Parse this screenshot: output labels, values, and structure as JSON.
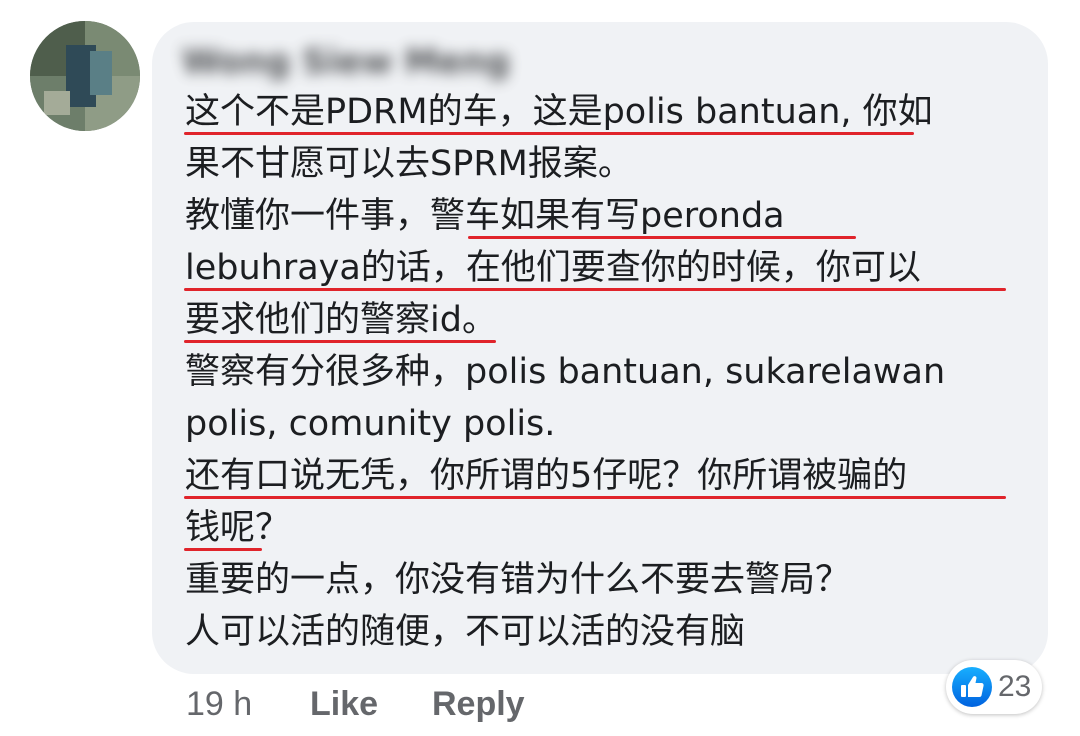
{
  "comment": {
    "author_name": "Wong Siew Meng",
    "lines": [
      "这个不是PDRM的车，这是polis bantuan, 你如",
      "果不甘愿可以去SPRM报案。",
      "教懂你一件事，警车如果有写peronda",
      "lebuhraya的话，在他们要查你的时候，你可以",
      "要求他们的警察id。",
      "警察有分很多种，polis bantuan, sukarelawan",
      "polis, comunity polis.",
      "还有口说无凭，你所谓的5仔呢？你所谓被骗的",
      "钱呢？",
      "重要的一点，你没有错为什么不要去警局？",
      "人可以活的随便，不可以活的没有脑"
    ],
    "underline_color": "#e0242b"
  },
  "footer": {
    "time": "19 h",
    "like_label": "Like",
    "reply_label": "Reply"
  },
  "reactions": {
    "icon": "thumbs-up-icon",
    "count": "23",
    "icon_color": "#1877f2"
  },
  "colors": {
    "bubble_bg": "#f0f2f5",
    "text": "#1c1e21",
    "meta_text": "#65676b"
  }
}
